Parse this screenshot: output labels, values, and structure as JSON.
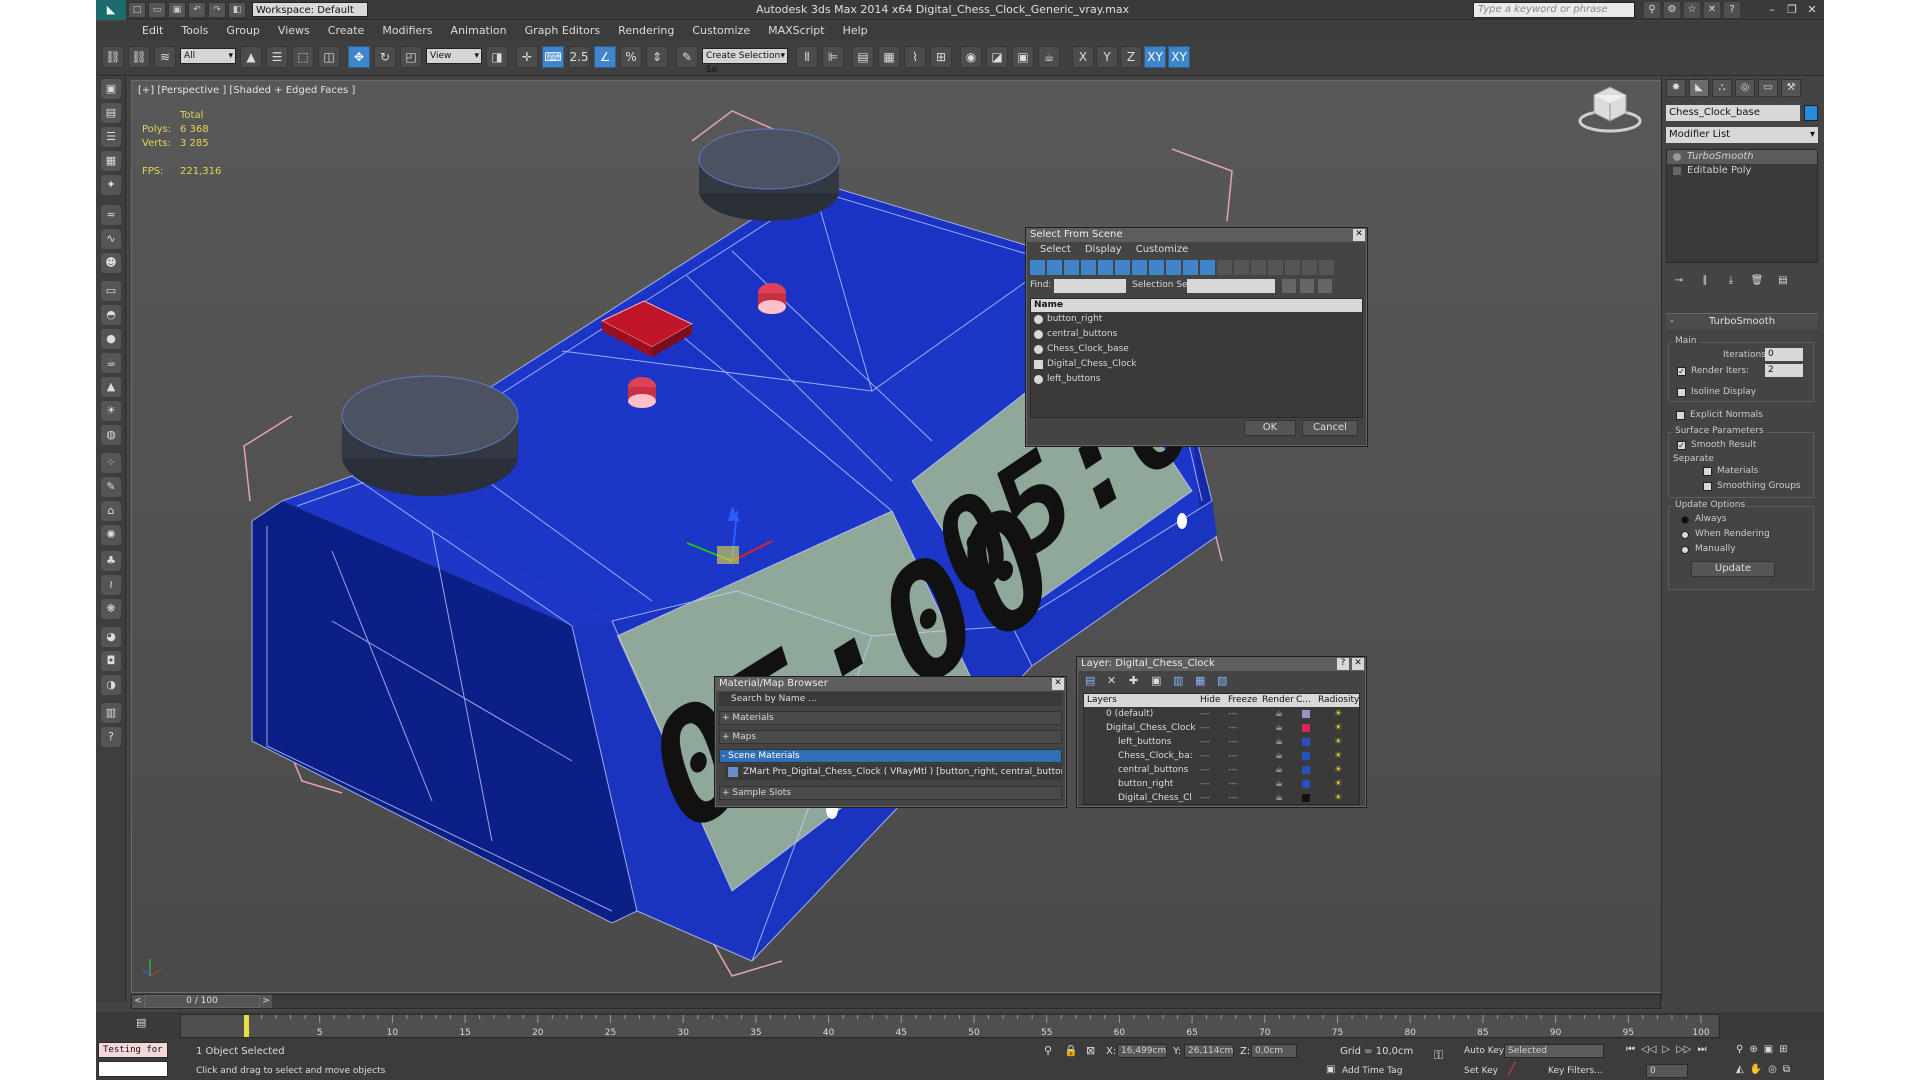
{
  "titlebar": {
    "workspace": "Workspace: Default",
    "title": "Autodesk 3ds Max  2014 x64      Digital_Chess_Clock_Generic_vray.max",
    "search_placeholder": "Type a keyword or phrase"
  },
  "menu": [
    "Edit",
    "Tools",
    "Group",
    "Views",
    "Create",
    "Modifiers",
    "Animation",
    "Graph Editors",
    "Rendering",
    "Customize",
    "MAXScript",
    "Help"
  ],
  "toolbar": {
    "filter": "All",
    "ref_coord": "View",
    "snap_angle": "2.5",
    "named_selection": "Create Selection Se",
    "axes": [
      "X",
      "Y",
      "Z",
      "XY",
      "XY"
    ]
  },
  "viewport": {
    "label": "[+] [Perspective ] [Shaded + Edged Faces ]",
    "stats": {
      "total_label": "Total",
      "polys_label": "Polys:",
      "polys": "6 368",
      "verts_label": "Verts:",
      "verts": "3 285",
      "fps_label": "FPS:",
      "fps": "221,316"
    },
    "display_time": "05:00"
  },
  "command_panel": {
    "object_name": "Chess_Clock_base",
    "modifier_list": "Modifier List",
    "stack": [
      "TurboSmooth",
      "Editable Poly"
    ],
    "rollout_title": "TurboSmooth",
    "main_label": "Main",
    "iterations_label": "Iterations:",
    "iterations": "0",
    "render_iters_label": "Render Iters:",
    "render_iters": "2",
    "isoline": "Isoline Display",
    "explicit_normals": "Explicit Normals",
    "surface_params": "Surface Parameters",
    "smooth_result": "Smooth Result",
    "separate": "Separate",
    "materials": "Materials",
    "smoothing_groups": "Smoothing Groups",
    "update_options": "Update Options",
    "always": "Always",
    "when_rendering": "When Rendering",
    "manually": "Manually",
    "update_button": "Update"
  },
  "select_from_scene": {
    "title": "Select From Scene",
    "menu": [
      "Select",
      "Display",
      "Customize"
    ],
    "find_label": "Find:",
    "selection_set_label": "Selection Set:",
    "col_name": "Name",
    "items": [
      "button_right",
      "central_buttons",
      "Chess_Clock_base",
      "Digital_Chess_Clock",
      "left_buttons"
    ],
    "ok": "OK",
    "cancel": "Cancel"
  },
  "material_browser": {
    "title": "Material/Map Browser",
    "search_placeholder": "Search by Name ...",
    "groups": [
      "+ Materials",
      "+ Maps",
      "- Scene Materials",
      "+ Sample Slots"
    ],
    "scene_material": "ZMart Pro_Digital_Chess_Clock  ( VRayMtl ) [button_right, central_buttons, Ches..."
  },
  "layer_dialog": {
    "title": "Layer: Digital_Chess_Clock",
    "columns": [
      "Layers",
      "Hide",
      "Freeze",
      "Render",
      "C...",
      "Radiosity"
    ],
    "rows": [
      {
        "name": "0 (default)",
        "color": "#9d8fd0"
      },
      {
        "name": "Digital_Chess_Clock",
        "color": "#d8285a"
      },
      {
        "name": "left_buttons",
        "color": "#2a4fc0"
      },
      {
        "name": "Chess_Clock_ba:",
        "color": "#2a4fc0"
      },
      {
        "name": "central_buttons",
        "color": "#2a4fc0"
      },
      {
        "name": "button_right",
        "color": "#2a4fc0"
      },
      {
        "name": "Digital_Chess_Cl",
        "color": "#111111"
      }
    ]
  },
  "timeline": {
    "frame": "0 / 100",
    "ticks": [
      "0",
      "5",
      "10",
      "15",
      "20",
      "25",
      "30",
      "35",
      "40",
      "45",
      "50",
      "55",
      "60",
      "65",
      "70",
      "75",
      "80",
      "85",
      "90",
      "95",
      "100"
    ]
  },
  "status": {
    "script_listener": "Testing for :",
    "selected": "1 Object Selected",
    "prompt": "Click and drag to select and move objects",
    "x_label": "X:",
    "x": "16,499cm",
    "y_label": "Y:",
    "y": "26,114cm",
    "z_label": "Z:",
    "z": "0,0cm",
    "grid": "Grid = 10,0cm",
    "auto_key": "Auto Key",
    "key_mode": "Selected",
    "add_time_tag": "Add Time Tag",
    "set_key": "Set Key",
    "key_filters": "Key Filters...",
    "current_frame": "0"
  }
}
